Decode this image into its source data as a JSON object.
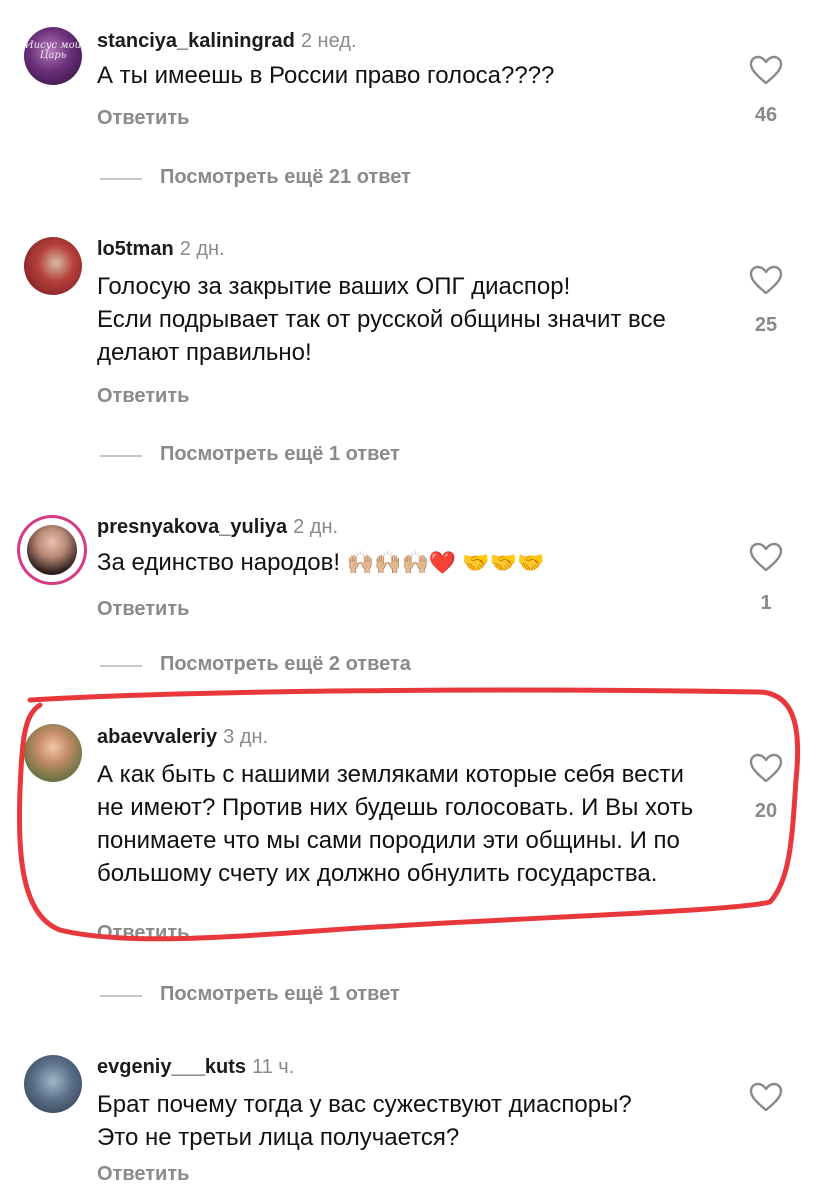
{
  "comments": [
    {
      "username": "stanciya_kaliningrad",
      "time": "2 нед.",
      "avatar_text": "Иисус мой Царь",
      "text": "А ты имеешь в России право голоса????",
      "reply_label": "Ответить",
      "likes": "46",
      "view_more": "Посмотреть ещё 21 ответ"
    },
    {
      "username": "lo5tman",
      "time": "2 дн.",
      "text": "Голосую за закрытие ваших ОПГ диаспор!\nЕсли подрывает так от русской общины значит все делают правильно!",
      "reply_label": "Ответить",
      "likes": "25",
      "view_more": "Посмотреть ещё 1 ответ"
    },
    {
      "username": "presnyakova_yuliya",
      "time": "2 дн.",
      "text": "За единство народов!",
      "emoji": "🙌🏼🙌🏼🙌🏼❤️ 🤝🤝🤝",
      "reply_label": "Ответить",
      "likes": "1",
      "view_more": "Посмотреть ещё 2 ответа"
    },
    {
      "username": "abaevvaleriy",
      "time": "3 дн.",
      "text": "А как быть с нашими  земляками которые себя вести не имеют?  Против них будешь голосовать. И Вы хоть понимаете что мы сами породили эти общины.  И по большому счету их должно обнулить государства.",
      "reply_label": "Ответить",
      "likes": "20",
      "view_more": "Посмотреть ещё 1 ответ"
    },
    {
      "username": "evgeniy___kuts",
      "time": "11 ч.",
      "text": "Брат почему тогда у вас сужествуют диаспоры?\nЭто не третьи лица  получается?",
      "reply_label": "Ответить"
    }
  ],
  "colors": {
    "highlight_circle": "#e8383b",
    "muted_text": "#8a8a8a",
    "story_ring": "#d63a84"
  },
  "icons": {
    "like": "heart-outline-icon"
  }
}
